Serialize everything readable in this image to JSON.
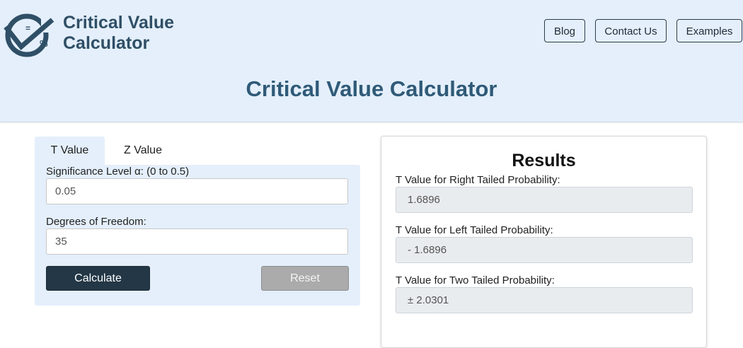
{
  "header": {
    "brand_line1": "Critical Value",
    "brand_line2": "Calculator",
    "nav": {
      "blog": "Blog",
      "contact": "Contact Us",
      "examples": "Examples"
    },
    "page_title": "Critical Value Calculator",
    "logo_symbols": {
      "equals": "=",
      "percent": "%"
    }
  },
  "calculator": {
    "tabs": [
      {
        "label": "T Value",
        "active": true
      },
      {
        "label": "Z Value",
        "active": false
      }
    ],
    "significance": {
      "label": "Significance Level α: (0 to 0.5)",
      "value": "0.05"
    },
    "dof": {
      "label": "Degrees of Freedom:",
      "value": "35"
    },
    "calculate_label": "Calculate",
    "reset_label": "Reset"
  },
  "results": {
    "title": "Results",
    "right": {
      "label": "T Value for Right Tailed Probability:",
      "value": "1.6896"
    },
    "left": {
      "label": "T Value for Left Tailed Probability:",
      "value": "- 1.6896"
    },
    "two": {
      "label": "T Value for Two Tailed Probability:",
      "value": "± 2.0301"
    }
  },
  "colors": {
    "header_bg": "#e4effb",
    "brand": "#2f4f66",
    "title": "#2f5a78",
    "calculate_bg": "#233746",
    "reset_bg": "#ababab"
  }
}
